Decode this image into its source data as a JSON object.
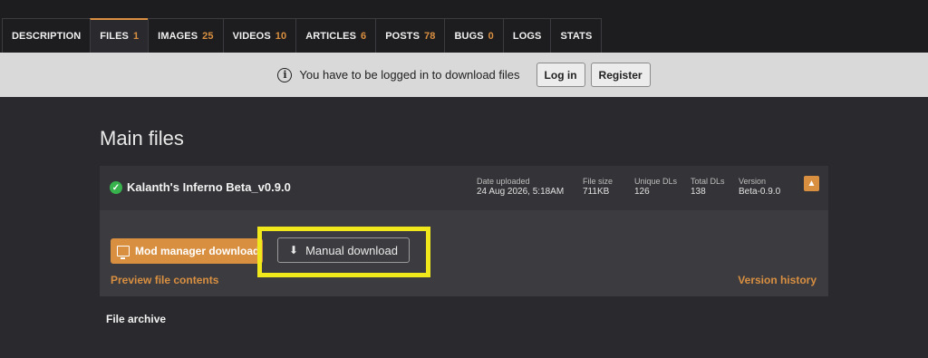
{
  "tabs": [
    {
      "label": "DESCRIPTION",
      "count": ""
    },
    {
      "label": "FILES",
      "count": "1"
    },
    {
      "label": "IMAGES",
      "count": "25"
    },
    {
      "label": "VIDEOS",
      "count": "10"
    },
    {
      "label": "ARTICLES",
      "count": "6"
    },
    {
      "label": "POSTS",
      "count": "78"
    },
    {
      "label": "BUGS",
      "count": "0"
    },
    {
      "label": "LOGS",
      "count": ""
    },
    {
      "label": "STATS",
      "count": ""
    }
  ],
  "banner": {
    "icon": "info-icon",
    "message": "You have to be logged in to download files",
    "login_label": "Log in",
    "register_label": "Register"
  },
  "main": {
    "title": "Main files",
    "file": {
      "name": "Kalanth's Inferno Beta_v0.9.0",
      "stats": [
        {
          "label": "Date uploaded",
          "value": "24 Aug 2026, 5:18AM"
        },
        {
          "label": "File size",
          "value": "711KB"
        },
        {
          "label": "Unique DLs",
          "value": "126"
        },
        {
          "label": "Total DLs",
          "value": "138"
        },
        {
          "label": "Version",
          "value": "Beta-0.9.0"
        }
      ],
      "mod_manager_label": "Mod manager download",
      "manual_label": "Manual download",
      "preview_label": "Preview file contents",
      "version_history_label": "Version history"
    },
    "archive_title": "File archive"
  },
  "colors": {
    "accent": "#d98f40",
    "highlight": "#f0e81a",
    "success": "#37b24d"
  }
}
